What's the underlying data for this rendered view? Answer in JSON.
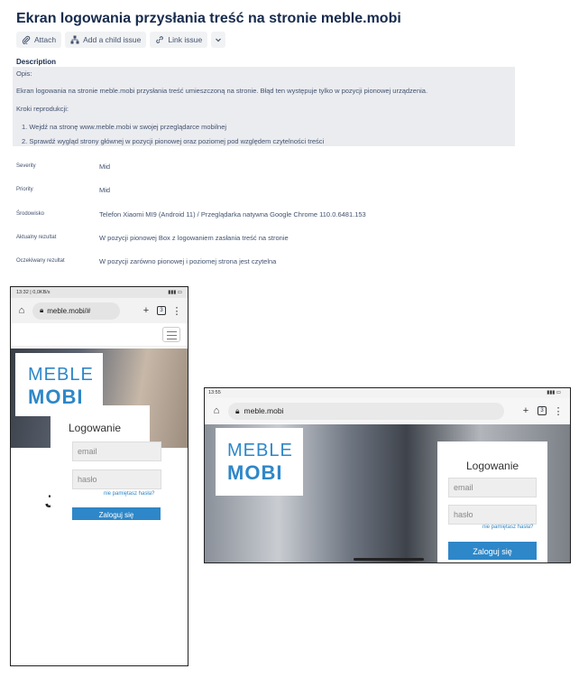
{
  "issue": {
    "title": "Ekran logowania przysłania treść na stronie meble.mobi",
    "toolbar": {
      "attach": "Attach",
      "add_child": "Add a child issue",
      "link_issue": "Link issue"
    },
    "description": {
      "heading": "Description",
      "opis": "Opis:",
      "text": "Ekran logowania na stronie meble.mobi przysłania treść umieszczoną na stronie. Błąd ten występuje tylko w pozycji pionowej urządzenia.",
      "steps_heading": "Kroki reprodukcji:",
      "steps": [
        "1. Wejdź na stronę www.meble.mobi w swojej przeglądarce mobilnej",
        "2. Sprawdź wygląd strony głównej w pozycji pionowej oraz poziomej pod względem czytelności treści"
      ]
    },
    "fields": [
      {
        "label": "Severity",
        "value": "Mid"
      },
      {
        "label": "Priority",
        "value": "Mid"
      },
      {
        "label": "Środowisko",
        "value": "Telefon Xiaomi MI9 (Android 11) / Przeglądarka natywna Google Chrome 110.0.6481.153"
      },
      {
        "label": "Aktualny rezultat",
        "value": "W pozycji pionowej Box z logowaniem zasłania treść na stronie"
      },
      {
        "label": "Oczekiwany rezultat",
        "value": "W pozycji zarówno pionowej i poziomej strona jest czytelna"
      }
    ]
  },
  "portrait": {
    "status_time": "13:32 | 0,0KB/s",
    "url": "meble.mobi/#",
    "tabs_count": "3",
    "logo_top": "MEBLE",
    "logo_bottom": "MOBI",
    "login_title": "Logowanie",
    "email_placeholder": "email",
    "password_placeholder": "hasło",
    "forgot": "nie pamiętasz hasła?",
    "login_button": "Zaloguj się",
    "partial_text": "Ja"
  },
  "landscape": {
    "status_time": "13:55",
    "url": "meble.mobi",
    "tabs_count": "3",
    "logo_top": "MEBLE",
    "logo_bottom": "MOBI",
    "login_title": "Logowanie",
    "email_placeholder": "email",
    "password_placeholder": "hasło",
    "forgot": "nie pamiętasz hasła?",
    "login_button": "Zaloguj się"
  },
  "colors": {
    "brand_blue": "#2e87c8",
    "desc_bg": "#ebecf0"
  }
}
